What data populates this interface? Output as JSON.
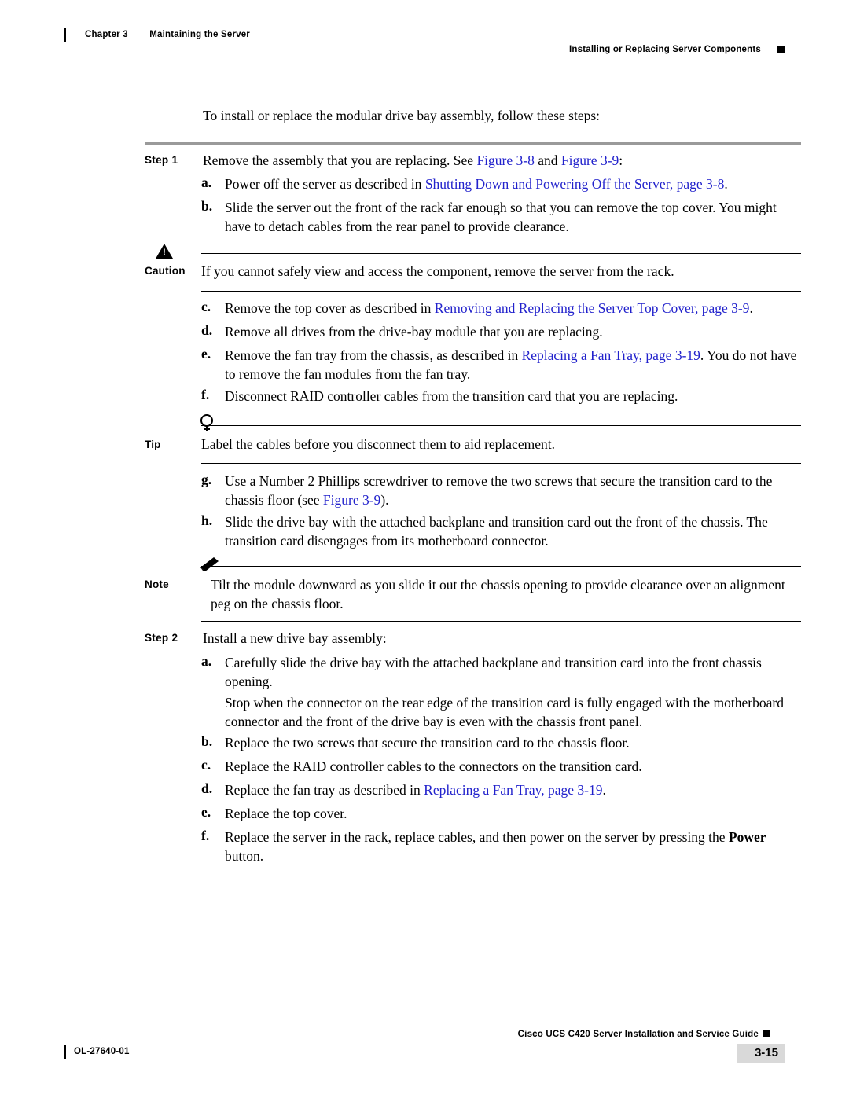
{
  "header": {
    "chapter_label": "Chapter 3",
    "chapter_title": "Maintaining the Server",
    "section": "Installing or Replacing Server Components"
  },
  "intro": "To install or replace the modular drive bay assembly, follow these steps:",
  "steps": [
    {
      "label": "Step 1",
      "text_before": "Remove the assembly that you are replacing. See ",
      "link1": "Figure",
      "link1b": "3-8",
      "mid": " and ",
      "link2": "Figure",
      "link2b": "3-9",
      "text_after": ":"
    },
    {
      "label": "Step 2",
      "text": "Install a new drive bay assembly:"
    }
  ],
  "step1_subitems": [
    {
      "letter": "a.",
      "pre": "Power off the server as described in ",
      "link": "Shutting Down and Powering Off the Server, page",
      "link_num": "3-8",
      "post": "."
    },
    {
      "letter": "b.",
      "pre": "Slide the server out the front of the rack far enough so that you can remove the top cover. You might have to detach cables from the rear panel to provide clearance.",
      "link": "",
      "link_num": "",
      "post": ""
    },
    {
      "letter": "c.",
      "pre": "Remove the top cover as described in ",
      "link": "Removing and Replacing the Server Top Cover, page",
      "link_num": "3-9",
      "post": "."
    },
    {
      "letter": "d.",
      "pre": "Remove all drives from the drive-bay module that you are replacing.",
      "link": "",
      "link_num": "",
      "post": ""
    },
    {
      "letter": "e.",
      "pre": "Remove the fan tray from the chassis, as described in ",
      "link": "Replacing a Fan Tray, page",
      "link_num": "3-19",
      "post": ". You do not have to remove the fan modules from the fan tray."
    },
    {
      "letter": "f.",
      "pre": "Disconnect RAID controller cables from the transition card that you are replacing.",
      "link": "",
      "link_num": "",
      "post": ""
    },
    {
      "letter": "g.",
      "pre": "Use a Number 2 Phillips screwdriver to remove the two screws that secure the transition card to the chassis floor (see ",
      "link": "Figure",
      "link_num": "3-9",
      "post": ")."
    },
    {
      "letter": "h.",
      "pre": "Slide the drive bay with the attached backplane and transition card out the front of the chassis. The transition card disengages from its motherboard connector.",
      "link": "",
      "link_num": "",
      "post": ""
    }
  ],
  "step2_subitems": [
    {
      "letter": "a.",
      "pre": "Carefully slide the drive bay with the attached backplane and transition card into the front chassis opening.",
      "link": "",
      "link_num": "",
      "post": ""
    },
    {
      "letter": "b.",
      "pre": "Replace the two screws that secure the transition card to the chassis floor.",
      "link": "",
      "link_num": "",
      "post": ""
    },
    {
      "letter": "c.",
      "pre": "Replace the RAID controller cables to the connectors on the transition card.",
      "link": "",
      "link_num": "",
      "post": ""
    },
    {
      "letter": "d.",
      "pre": "Replace the fan tray as described in ",
      "link": "Replacing a Fan Tray, page",
      "link_num": "3-19",
      "post": "."
    },
    {
      "letter": "e.",
      "pre": "Replace the top cover.",
      "link": "",
      "link_num": "",
      "post": ""
    },
    {
      "letter": "f.",
      "pre": "Replace the server in the rack, replace cables, and then power on the server by pressing the ",
      "bold": "Power",
      "post": " button.",
      "link": "",
      "link_num": ""
    }
  ],
  "step2_note_para": "Stop when the connector on the rear edge of the transition card is fully engaged with the motherboard connector and the front of the drive bay is even with the chassis front panel.",
  "admonitions": {
    "caution": {
      "label": "Caution",
      "icon": "caution-triangle-icon",
      "text": "If you cannot safely view and access the component, remove the server from the rack."
    },
    "tip": {
      "label": "Tip",
      "icon": "tip-lightbulb-icon",
      "text": "Label the cables before you disconnect them to aid replacement."
    },
    "note": {
      "label": "Note",
      "icon": "note-pencil-icon",
      "text": "Tilt the module downward as you slide it out the chassis opening to provide clearance over an alignment peg on the chassis floor."
    }
  },
  "footer": {
    "doc_id": "OL-27640-01",
    "guide_title": "Cisco UCS C420 Server Installation and Service Guide",
    "page_number": "3-15"
  },
  "colors": {
    "link": "#2222cc",
    "rule": "#9a9a9a",
    "page_box": "#d9d9d9"
  }
}
